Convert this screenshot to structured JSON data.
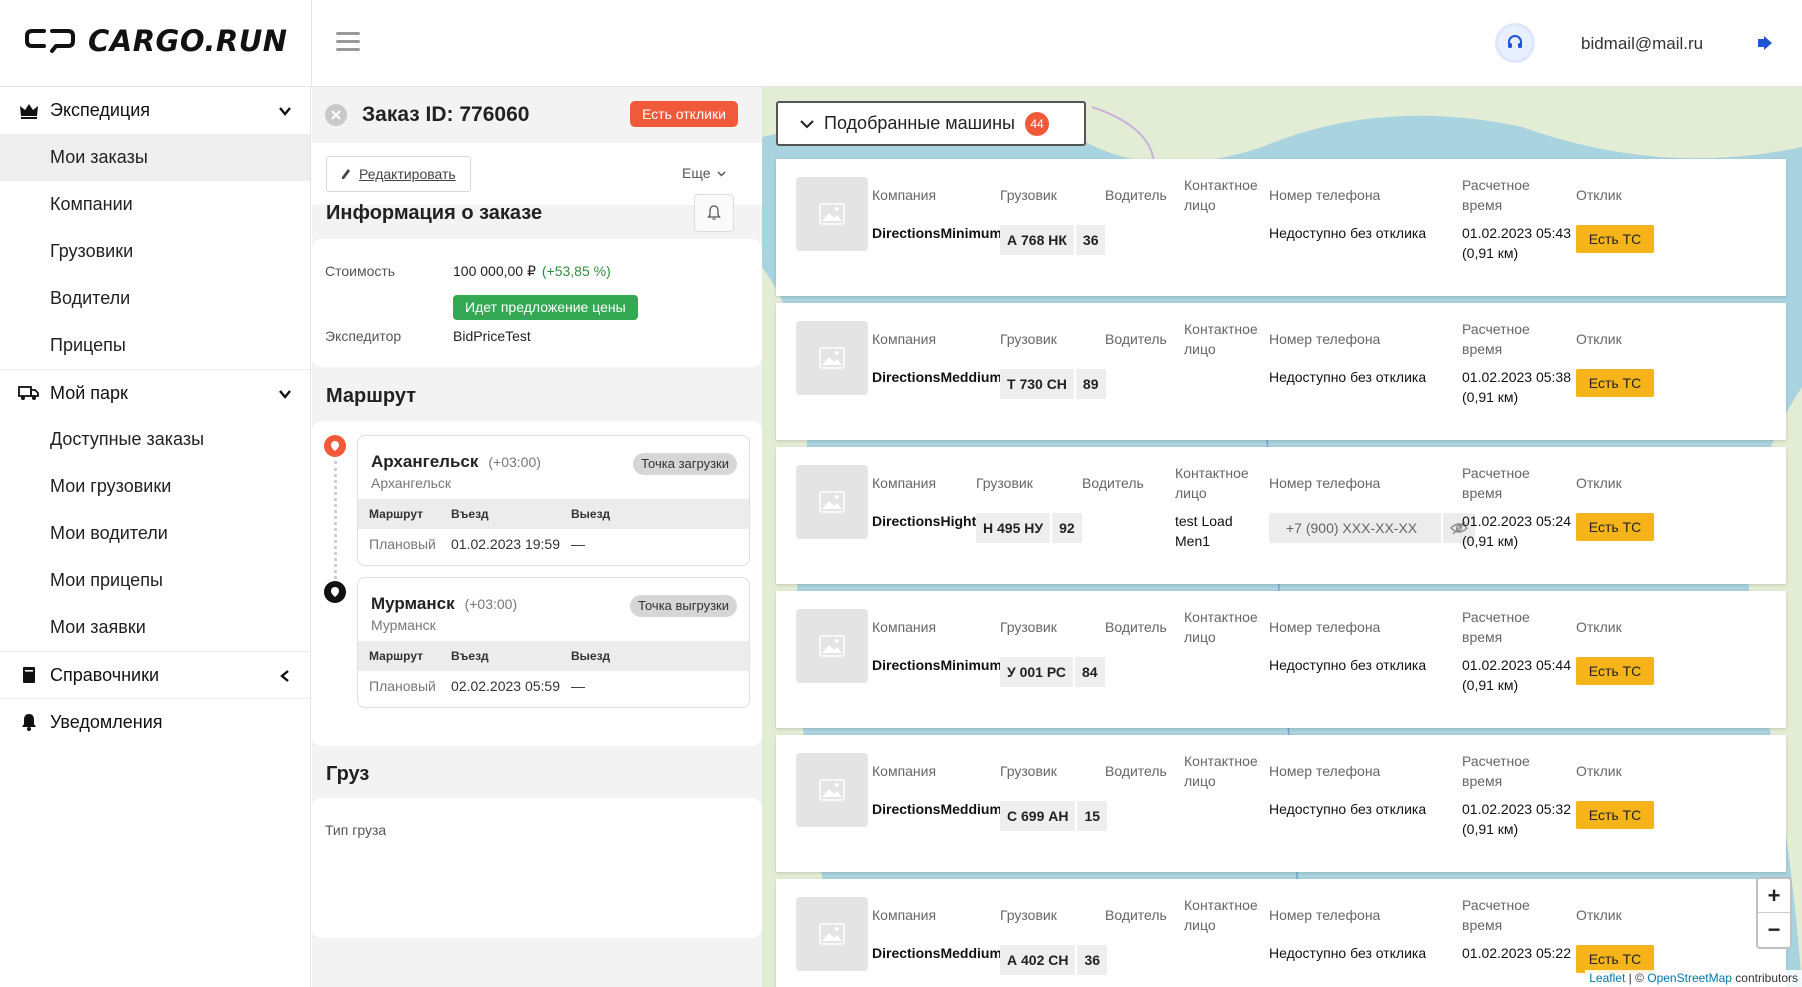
{
  "header": {
    "logo_text": "CARGO.RUN",
    "user_email": "bidmail@mail.ru"
  },
  "sidebar": {
    "groups": [
      {
        "label": "Экспедиция",
        "icon": "crown-icon",
        "chevron": "down",
        "items": [
          "Мои заказы",
          "Компании",
          "Грузовики",
          "Водители",
          "Прицепы"
        ]
      },
      {
        "label": "Мой парк",
        "icon": "truck-icon",
        "chevron": "down",
        "items": [
          "Доступные заказы",
          "Мои грузовики",
          "Мои водители",
          "Мои прицепы",
          "Мои заявки"
        ]
      },
      {
        "label": "Справочники",
        "icon": "book-icon",
        "chevron": "left",
        "items": []
      },
      {
        "label": "Уведомления",
        "icon": "bell-icon",
        "chevron": "",
        "items": []
      }
    ],
    "active_item": "Мои заказы"
  },
  "order": {
    "title": "Заказ ID: 776060",
    "responses_badge": "Есть отклики",
    "edit_label": "Редактировать",
    "more_label": "Еще",
    "info_title": "Информация о заказе",
    "price_label": "Стоимость",
    "price_value": "100 000,00 ₽",
    "price_diff": "(+53,85 %)",
    "price_status": "Идет предложение цены",
    "forwarder_label": "Экспедитор",
    "forwarder_value": "BidPriceTest",
    "route_title": "Маршрут",
    "cargo_title": "Груз",
    "cargo_type_label": "Тип груза",
    "route_table_headers": [
      "Маршрут",
      "Въезд",
      "Выезд"
    ],
    "stops": [
      {
        "city": "Архангельск",
        "tz": "(+03:00)",
        "sub": "Архангельск",
        "badge": "Точка загрузки",
        "row": [
          "Плановый",
          "01.02.2023 19:59",
          "—"
        ]
      },
      {
        "city": "Мурманск",
        "tz": "(+03:00)",
        "sub": "Мурманск",
        "badge": "Точка выгрузки",
        "row": [
          "Плановый",
          "02.02.2023 05:59",
          "—"
        ]
      }
    ]
  },
  "matches": {
    "title": "Подобранные машины",
    "count": "44",
    "labels": {
      "company": "Компания",
      "truck": "Грузовик",
      "driver": "Водитель",
      "contact_1": "Контактное",
      "contact_2": "лицо",
      "phone": "Номер телефона",
      "time_1": "Расчетное",
      "time_2": "время",
      "response": "Отклик"
    },
    "cars": [
      {
        "company": "DirectionsMinimum",
        "plate": "А 768 НК",
        "region": "36",
        "contact_1": "",
        "contact_2": "",
        "phone": "Недоступно без отклика",
        "phone_hidden": false,
        "time": "01.02.2023 05:43",
        "distance": "(0,91 км)",
        "button": "Есть ТС"
      },
      {
        "company": "DirectionsMeddium",
        "plate": "Т 730 СН",
        "region": "89",
        "contact_1": "",
        "contact_2": "",
        "phone": "Недоступно без отклика",
        "phone_hidden": false,
        "time": "01.02.2023 05:38",
        "distance": "(0,91 км)",
        "button": "Есть ТС"
      },
      {
        "company": "DirectionsHight",
        "plate": "Н 495 НУ",
        "region": "92",
        "contact_1": "test Load",
        "contact_2": "Men1",
        "phone": "+7 (900) XXX-XX-XX",
        "phone_hidden": true,
        "time": "01.02.2023 05:24",
        "distance": "(0,91 км)",
        "button": "Есть ТС"
      },
      {
        "company": "DirectionsMinimum",
        "plate": "У 001 РС",
        "region": "84",
        "contact_1": "",
        "contact_2": "",
        "phone": "Недоступно без отклика",
        "phone_hidden": false,
        "time": "01.02.2023 05:44",
        "distance": "(0,91 км)",
        "button": "Есть ТС"
      },
      {
        "company": "DirectionsMeddium",
        "plate": "С 699 АН",
        "region": "15",
        "contact_1": "",
        "contact_2": "",
        "phone": "Недоступно без отклика",
        "phone_hidden": false,
        "time": "01.02.2023 05:32",
        "distance": "(0,91 км)",
        "button": "Есть ТС"
      },
      {
        "company": "DirectionsMeddium",
        "plate": "А 402 СН",
        "region": "36",
        "contact_1": "",
        "contact_2": "",
        "phone": "Недоступно без отклика",
        "phone_hidden": false,
        "time": "01.02.2023 05:22",
        "distance": "",
        "button": "Есть ТС"
      }
    ]
  },
  "map": {
    "zoom_in": "+",
    "zoom_out": "−",
    "attribution_leaflet": "Leaflet",
    "attribution_sep": " | © ",
    "attribution_osm": "OpenStreetMap",
    "attribution_rest": " contributors"
  },
  "colors": {
    "accent_red": "#f05a3a",
    "accent_green": "#34a853",
    "button_yellow": "#f5b51a",
    "map_water": "#a9d3df",
    "map_land": "#e3ecd5"
  }
}
